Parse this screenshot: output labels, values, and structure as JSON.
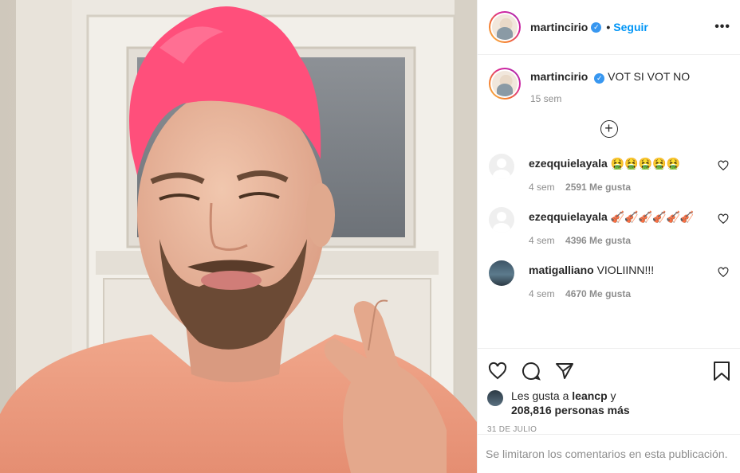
{
  "post": {
    "username": "martincirio",
    "follow_label": "Seguir",
    "more_label": "•••"
  },
  "caption": {
    "username": "martincirio",
    "text": "VOT SI VOT NO",
    "age": "15 sem"
  },
  "load_more_label": "+",
  "comments": [
    {
      "username": "ezeqquielayala",
      "text": "🤮🤮🤮🤮🤮",
      "age": "4 sem",
      "likes": "2591 Me gusta"
    },
    {
      "username": "ezeqquielayala",
      "text": "🎻🎻🎻🎻🎻🎻",
      "age": "4 sem",
      "likes": "4396 Me gusta"
    },
    {
      "username": "matigalliano",
      "text": "VIOLIINN!!!",
      "age": "4 sem",
      "likes": "4670 Me gusta"
    }
  ],
  "liked_by": {
    "prefix": "Les gusta a",
    "user": "leancp",
    "conj": "y",
    "count": "208,816 personas más"
  },
  "date": "31 DE JULIO",
  "comments_limited": "Se limitaron los comentarios en esta publicación.",
  "icons": {
    "like": "heart-icon",
    "comment": "comment-icon",
    "share": "paper-plane-icon",
    "save": "bookmark-icon",
    "verified": "verified-badge-icon",
    "load_more": "plus-circle-icon"
  },
  "colors": {
    "link": "#0095f6",
    "verified": "#3897f0",
    "muted": "#8e8e8e",
    "text": "#262626"
  }
}
